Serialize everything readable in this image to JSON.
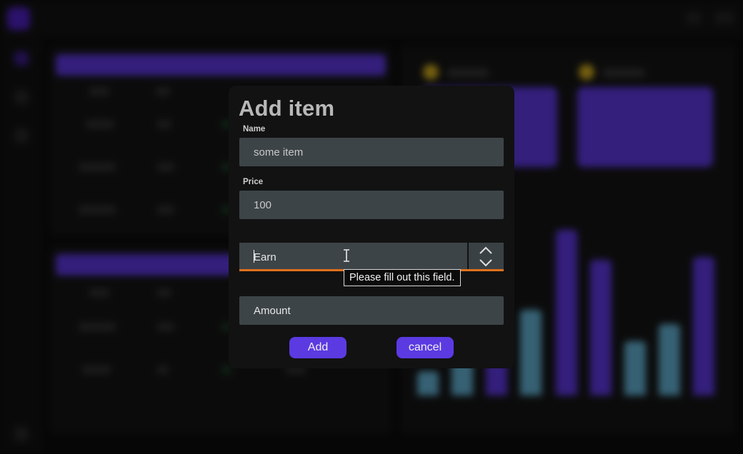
{
  "modal": {
    "title": "Add item",
    "name_label": "Name",
    "name_value": "some item",
    "price_label": "Price",
    "price_value": "100",
    "type_value": "Earn",
    "amount_placeholder": "Amount",
    "tooltip": "Please fill out this field.",
    "add_label": "Add",
    "cancel_label": "cancel"
  },
  "colors": {
    "accent": "#5b3ae2",
    "focus_underline": "#e2711d",
    "field_bg": "#3d4447"
  }
}
